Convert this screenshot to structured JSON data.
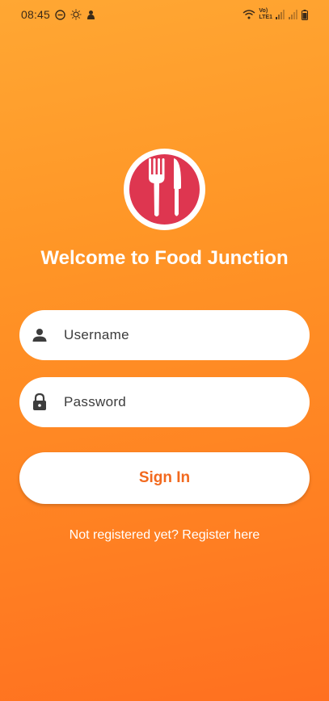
{
  "status_bar": {
    "time": "08:45",
    "left_icons": [
      "dnd-icon",
      "brightness-icon",
      "notification-icon"
    ],
    "right_icons": [
      "wifi-icon",
      "volte-icon",
      "signal-icon",
      "signal-icon",
      "battery-icon"
    ],
    "volte_label": "Vo)",
    "lte_label": "LTE1"
  },
  "logo": {
    "icon": "fork-knife-icon",
    "ring_color": "#FFFFFF",
    "fill_color": "#DE3650"
  },
  "header": {
    "title": "Welcome to Food Junction"
  },
  "form": {
    "username_placeholder": "Username",
    "username_icon": "person-icon",
    "password_placeholder": "Password",
    "password_icon": "lock-icon",
    "signin_label": "Sign In"
  },
  "footer": {
    "register_text": "Not registered yet? Register here"
  },
  "colors": {
    "accent": "#F2691E",
    "background_top": "#FFA733",
    "background_bottom": "#FF7020"
  }
}
